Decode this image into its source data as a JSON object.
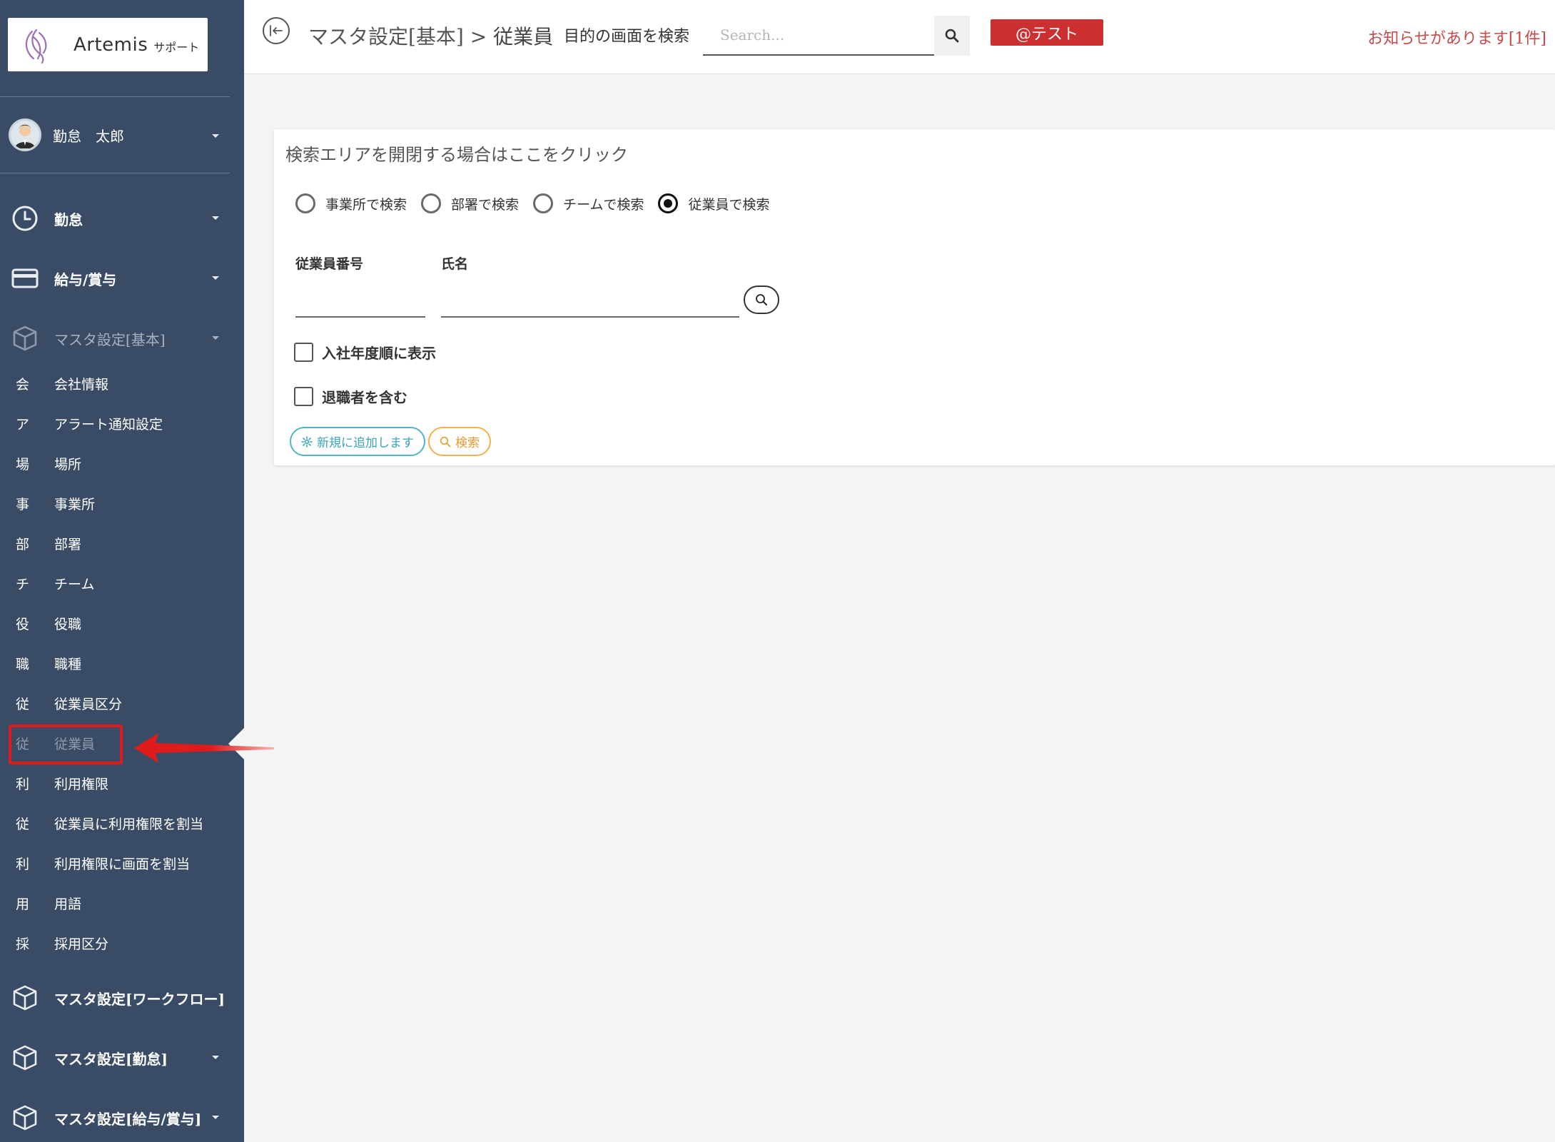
{
  "logo": {
    "name": "Artemis",
    "sub": "サポート"
  },
  "user": {
    "name": "勤怠　太郎"
  },
  "sidebar": {
    "sections_top": [
      {
        "label": "勤怠",
        "icon": "clock-icon"
      },
      {
        "label": "給与/賞与",
        "icon": "credit-card-icon"
      },
      {
        "label": "マスタ設定[基本]",
        "icon": "cube-icon"
      }
    ],
    "items": [
      {
        "initial": "会",
        "label": "会社情報"
      },
      {
        "initial": "ア",
        "label": "アラート通知設定"
      },
      {
        "initial": "場",
        "label": "場所"
      },
      {
        "initial": "事",
        "label": "事業所"
      },
      {
        "initial": "部",
        "label": "部署"
      },
      {
        "initial": "チ",
        "label": "チーム"
      },
      {
        "initial": "役",
        "label": "役職"
      },
      {
        "initial": "職",
        "label": "職種"
      },
      {
        "initial": "従",
        "label": "従業員区分"
      },
      {
        "initial": "従",
        "label": "従業員"
      },
      {
        "initial": "利",
        "label": "利用権限"
      },
      {
        "initial": "従",
        "label": "従業員に利用権限を割当"
      },
      {
        "initial": "利",
        "label": "利用権限に画面を割当"
      },
      {
        "initial": "用",
        "label": "用語"
      },
      {
        "initial": "採",
        "label": "採用区分"
      }
    ],
    "sections_bottom": [
      {
        "label": "マスタ設定[ワークフロー]",
        "icon": "cube-icon"
      },
      {
        "label": "マスタ設定[勤怠]",
        "icon": "cube-icon"
      },
      {
        "label": "マスタ設定[給与/賞与]",
        "icon": "cube-icon"
      }
    ]
  },
  "header": {
    "breadcrumb_parent": "マスタ設定[基本]",
    "breadcrumb_sep": ">",
    "breadcrumb_current": "従業員",
    "screen_search_label": "目的の画面を検索",
    "search_placeholder": "Search...",
    "badge": "@テスト",
    "notice": "お知らせがあります[1件]"
  },
  "search_card": {
    "toggle_text": "検索エリアを開閉する場合はここをクリック",
    "radios": [
      {
        "label": "事業所で検索",
        "selected": false
      },
      {
        "label": "部署で検索",
        "selected": false
      },
      {
        "label": "チームで検索",
        "selected": false
      },
      {
        "label": "従業員で検索",
        "selected": true
      }
    ],
    "employee_no_label": "従業員番号",
    "employee_no_value": "",
    "name_label": "氏名",
    "name_value": "",
    "checks": [
      {
        "label": "入社年度順に表示",
        "checked": false
      },
      {
        "label": "退職者を含む",
        "checked": false
      }
    ],
    "add_button": "新規に追加します",
    "search_button": "検索"
  },
  "colors": {
    "sidebar_bg": "#3a4c65",
    "badge_bg": "#cc2f2f",
    "notice": "#c64a4a",
    "add_button": "#3aa4b8",
    "search_button": "#e89a2c",
    "annotation": "#e01b1b"
  }
}
